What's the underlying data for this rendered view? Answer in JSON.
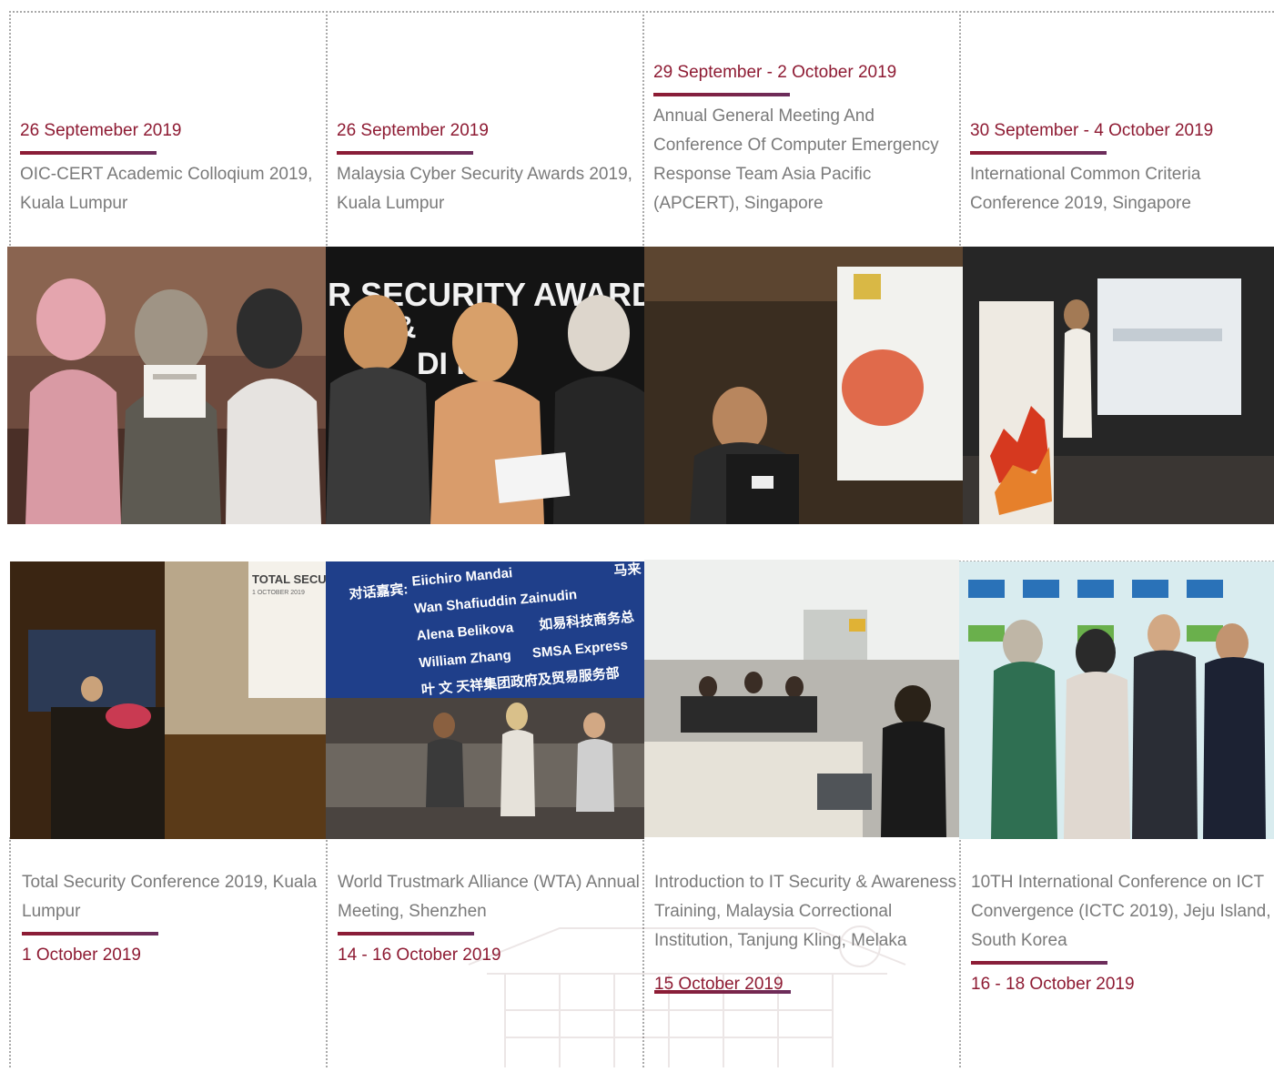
{
  "colors": {
    "date": "#8e1b33",
    "title": "#7a7a7a",
    "bar_start": "#8e1b33",
    "bar_end": "#6b2d5c"
  },
  "top_row": [
    {
      "date": "26 Septemeber 2019",
      "title": "OIC-CERT Academic Colloqium 2019, Kuala Lumpur",
      "photo": "award-certificate-photo"
    },
    {
      "date": "26 September 2019",
      "title": "Malaysia Cyber Security Awards 2019, Kuala Lumpur",
      "photo": "cyber-security-awards-photo"
    },
    {
      "date": "29 September - 2 October 2019",
      "title": "Annual General Meeting And Conference Of Computer Emergency Response Team Asia Pacific (APCERT), Singapore",
      "photo": "apcert-speaker-photo"
    },
    {
      "date": "30 September - 4 October 2019",
      "title": "International Common Criteria Conference 2019, Singapore",
      "photo": "iccc-stage-photo"
    }
  ],
  "bottom_row": [
    {
      "date": "1 October 2019",
      "title": "Total Security Conference 2019, Kuala Lumpur",
      "photo": "total-security-podium-photo"
    },
    {
      "date": "14 - 16 October 2019",
      "title": "World Trustmark Alliance (WTA) Annual Meeting, Shenzhen",
      "photo": "wta-panel-photo"
    },
    {
      "date": "15 October 2019",
      "title": "Introduction to IT Security & Awareness Training, Malaysia Correctional Institution, Tanjung Kling, Melaka",
      "photo": "training-classroom-photo"
    },
    {
      "date": "16 - 18 October  2019",
      "title": "10TH International Conference on ICT Convergence (ICTC 2019), Jeju Island, South Korea",
      "photo": "ictc-group-photo"
    }
  ],
  "photo_text": {
    "awards_banner_line1": "R SECURITY AWARDS",
    "awards_banner_line2": "&",
    "awards_banner_line3": "DI    R",
    "total_security_screen": "TOTAL SECU",
    "total_security_screen_sub": "1 OCTOBER 2019",
    "wta_names": [
      "Eiichiro Mandai",
      "Wan Shafiuddin Zainudin",
      "Alena Belikova",
      "William Zhang",
      "SMSA Express",
      "叶  文  天祥集团政府及贸易服务部"
    ],
    "wta_prefix": "对话嘉宾:",
    "wta_side_1": "马来",
    "wta_side_2": "如易科技商务总"
  }
}
